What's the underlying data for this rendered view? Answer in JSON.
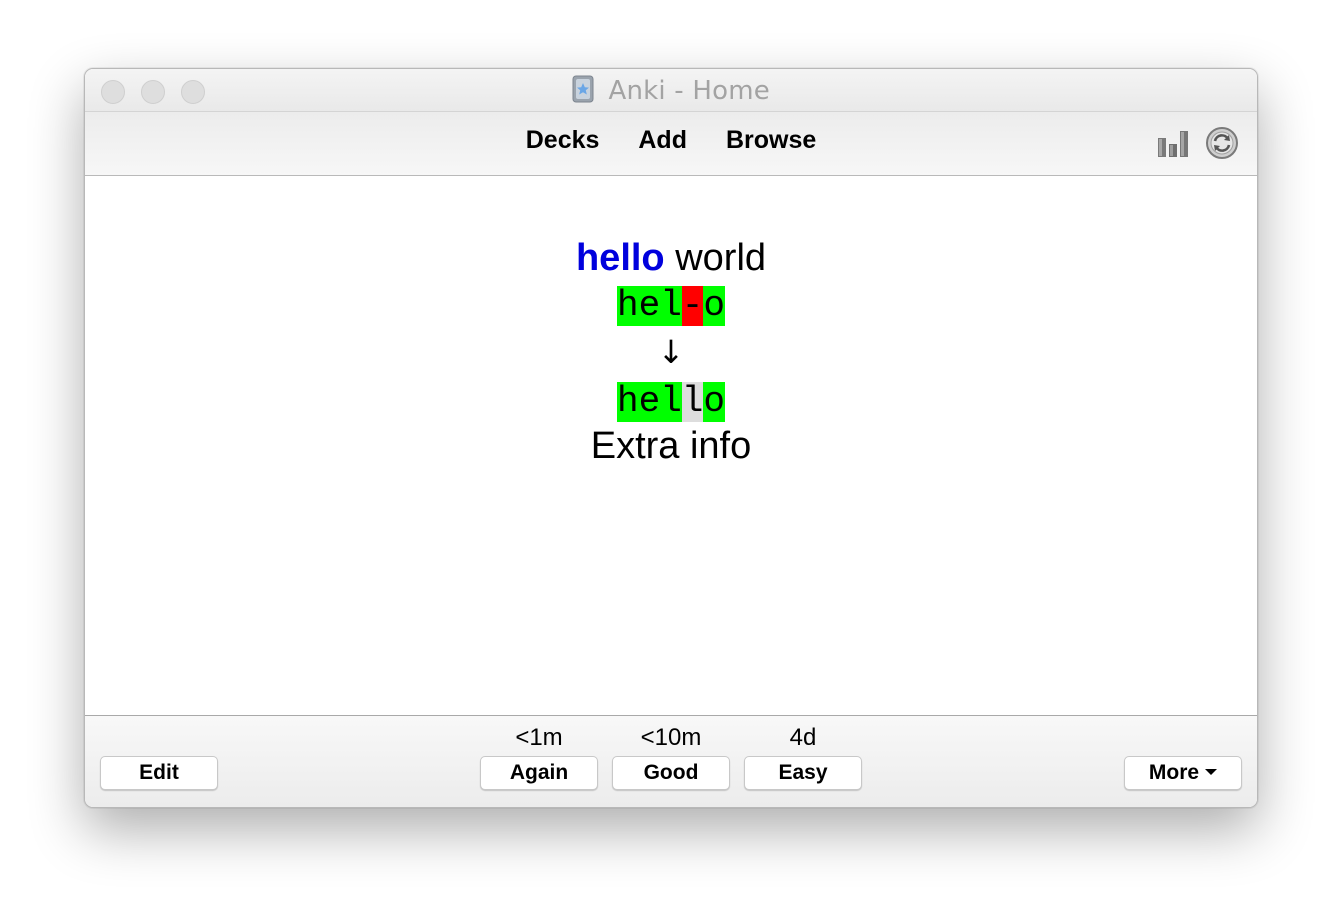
{
  "window": {
    "title": "Anki - Home"
  },
  "toolbar": {
    "nav": [
      "Decks",
      "Add",
      "Browse"
    ],
    "icons": [
      "stats-icon",
      "sync-icon"
    ]
  },
  "card": {
    "question_bold": "hello",
    "question_rest": " world",
    "typed_answer": {
      "good_1": "hel",
      "bad": "-",
      "good_2": "o"
    },
    "arrow": "↓",
    "correct_answer": {
      "good_1": "hel",
      "missed": "l",
      "good_2": "o"
    },
    "extra": "Extra info"
  },
  "bottom": {
    "edit_label": "Edit",
    "answers": [
      {
        "label": "Again",
        "interval": "<1m"
      },
      {
        "label": "Good",
        "interval": "<10m"
      },
      {
        "label": "Easy",
        "interval": "4d"
      }
    ],
    "more_label": "More"
  },
  "colors": {
    "correct": "#00ff00",
    "incorrect": "#ff0000",
    "missing": "#dddddd",
    "highlight_text": "#0000dd"
  }
}
